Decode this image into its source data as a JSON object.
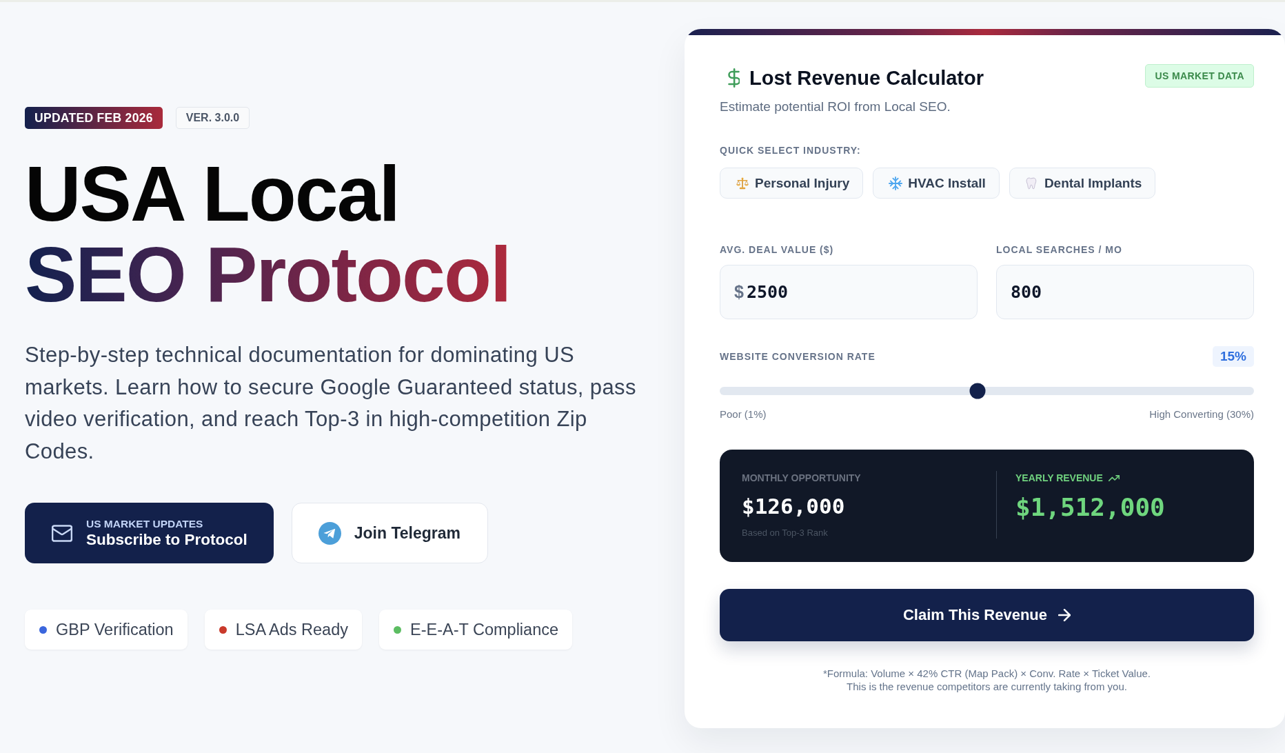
{
  "hero": {
    "badges": [
      {
        "kind": "highlight",
        "label": "UPDATED FEB 2026"
      },
      {
        "kind": "outline",
        "label": "VER. 3.0.0"
      }
    ],
    "title": "USA Local",
    "title_highlight": "SEO Protocol",
    "description": "Step-by-step technical documentation for dominating US markets. Learn how to secure Google Guaranteed status, pass video verification, and reach Top-3 in high-competition Zip Codes.",
    "actions": [
      {
        "kind": "primary",
        "eyebrow": "US MARKET UPDATES",
        "label": "Subscribe to Protocol"
      },
      {
        "kind": "secondary",
        "label": "Join Telegram"
      }
    ],
    "features": [
      {
        "label": "GBP Verification",
        "color": "#3b66dd"
      },
      {
        "label": "LSA Ads Ready",
        "color": "#c9392b"
      },
      {
        "label": "E-E-A-T Compliance",
        "color": "#5cbd62"
      }
    ]
  },
  "calculator": {
    "title": "Lost Revenue Calculator",
    "subtitle": "Estimate potential ROI from Local SEO.",
    "badge": "US MARKET DATA",
    "industry_label": "QUICK SELECT INDUSTRY:",
    "industries": [
      {
        "label": "Personal Injury"
      },
      {
        "label": "HVAC Install"
      },
      {
        "label": "Dental Implants"
      }
    ],
    "inputs": [
      {
        "label": "AVG. DEAL VALUE ($)",
        "prefix": "$",
        "value": "2500"
      },
      {
        "label": "LOCAL SEARCHES / MO",
        "value": "800"
      }
    ],
    "conversion": {
      "label": "WEBSITE CONVERSION RATE",
      "reading": "15%",
      "level": 0.483,
      "min_label": "Poor (1%)",
      "max_label": "High Converting (30%)"
    },
    "results": [
      {
        "kind": "monthly",
        "label": "MONTHLY OPPORTUNITY",
        "value": "$126,000",
        "note": "Based on Top-3 Rank"
      },
      {
        "kind": "yearly",
        "label": "YEARLY REVENUE",
        "value": "$1,512,000"
      }
    ],
    "cta": "Claim This Revenue",
    "footnote": [
      "*Formula: Volume × 42% CTR (Map Pack) × Conv. Rate × Ticket Value.",
      "This is the revenue competitors are currently taking from you."
    ]
  }
}
